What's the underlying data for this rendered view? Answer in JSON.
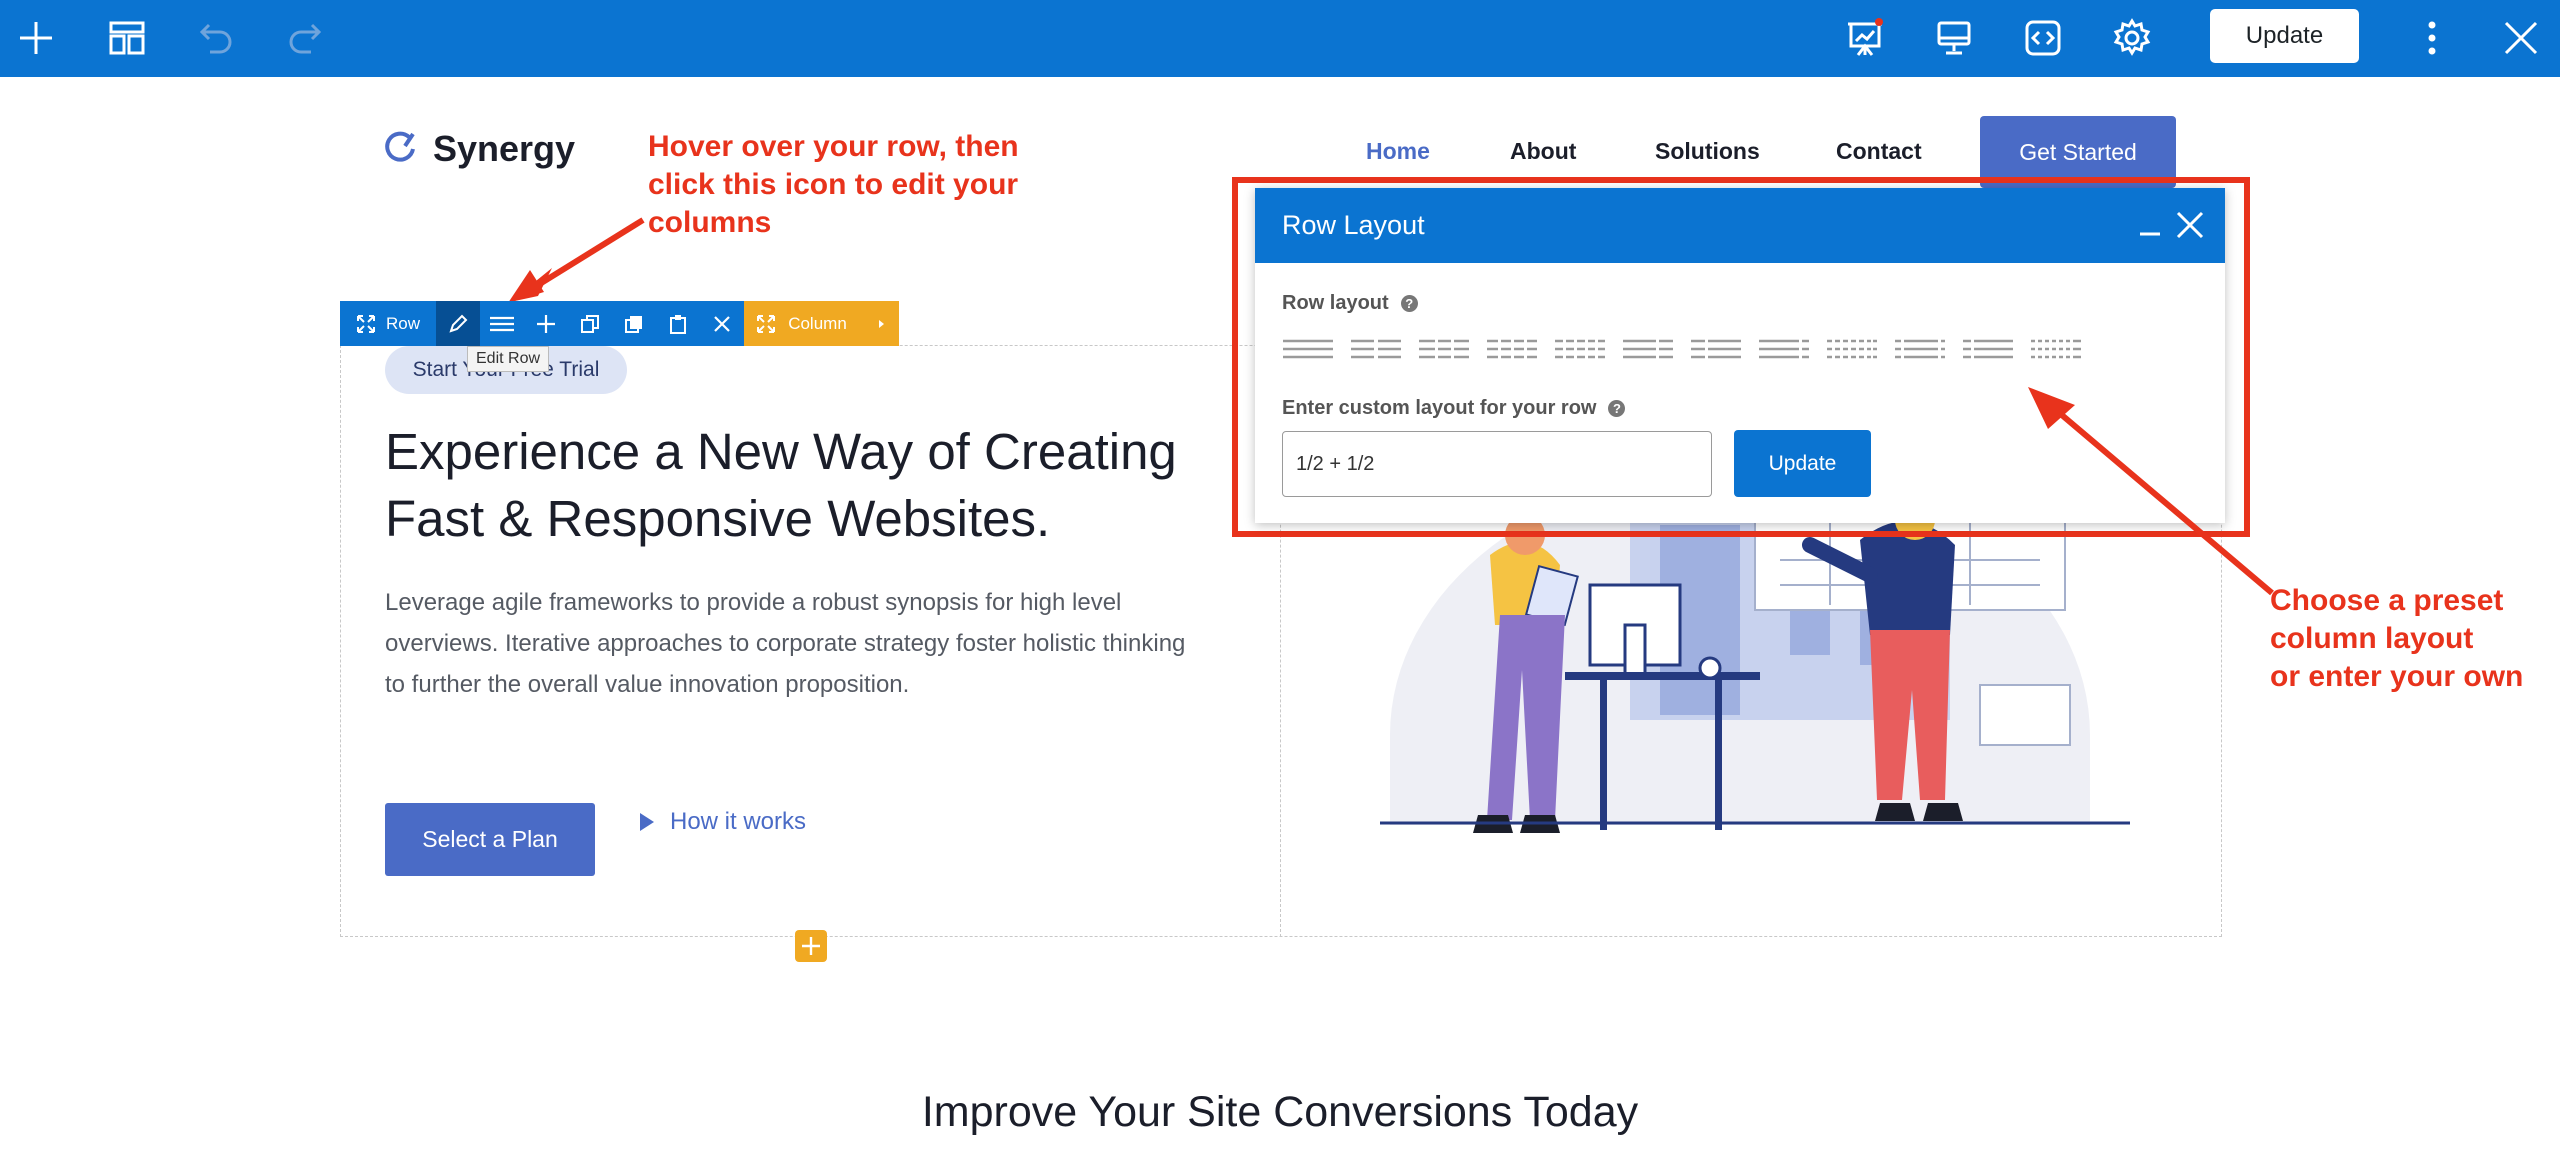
{
  "toolbar": {
    "update_label": "Update",
    "icons": [
      "plus-icon",
      "layout-icon",
      "undo-icon",
      "redo-icon",
      "presentation-icon",
      "desktop-icon",
      "code-icon",
      "gear-icon",
      "more-icon",
      "close-icon"
    ]
  },
  "site": {
    "logo_text": "Synergy",
    "nav": [
      "Home",
      "About",
      "Solutions",
      "Contact"
    ],
    "cta": "Get Started"
  },
  "annotations": {
    "top": [
      "Hover over your row, then",
      "click this icon to edit your",
      "columns"
    ],
    "right": [
      "Choose a preset",
      "column layout",
      "or enter your own"
    ]
  },
  "row_toolbar": {
    "row_label": "Row",
    "column_label": "Column",
    "tooltip": "Edit Row"
  },
  "hero": {
    "badge": "Start Your Free Trial",
    "headline_1": "Experience a New Way of Creating",
    "headline_2": "Fast & Responsive Websites.",
    "para_1": "Leverage agile frameworks to provide a robust synopsis for high level",
    "para_2": "overviews. Iterative approaches to corporate strategy foster holistic thinking",
    "para_3": "to further the overall value innovation proposition.",
    "primary_button": "Select a Plan",
    "secondary_link": "How it works"
  },
  "section2": {
    "title": "Improve Your Site Conversions Today"
  },
  "dialog": {
    "title": "Row Layout",
    "row_layout_label": "Row layout",
    "custom_label": "Enter custom layout for your row",
    "custom_value": "1/2 + 1/2",
    "update_label": "Update",
    "help_glyph": "?"
  },
  "colors": {
    "accent": "#0b74d1",
    "brand": "#4a6bc6",
    "annotation": "#e8331c",
    "column_toolbar": "#f0a922"
  }
}
